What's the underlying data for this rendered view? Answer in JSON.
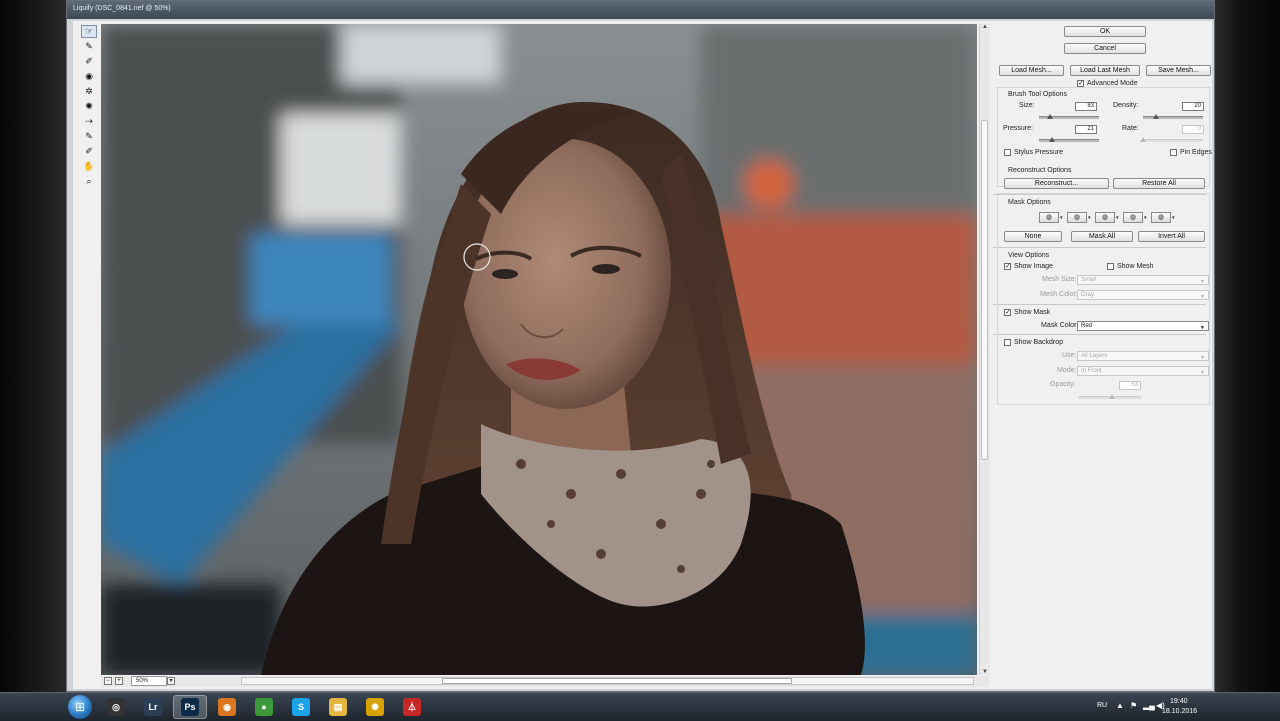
{
  "window": {
    "title": "Liquify (DSC_0841.nef @ 50%)"
  },
  "tools": [
    {
      "name": "forward-warp-tool-icon",
      "glyph": "☞"
    },
    {
      "name": "reconstruct-tool-icon",
      "glyph": "✎"
    },
    {
      "name": "smooth-tool-icon",
      "glyph": "✐"
    },
    {
      "name": "twirl-tool-icon",
      "glyph": "◉"
    },
    {
      "name": "pucker-tool-icon",
      "glyph": "✲"
    },
    {
      "name": "bloat-tool-icon",
      "glyph": "✺"
    },
    {
      "name": "push-left-tool-icon",
      "glyph": "⇢"
    },
    {
      "name": "freeze-mask-tool-icon",
      "glyph": "✎"
    },
    {
      "name": "thaw-mask-tool-icon",
      "glyph": "✐"
    },
    {
      "name": "hand-tool-icon",
      "glyph": "✋"
    },
    {
      "name": "zoom-tool-icon",
      "glyph": "⌕"
    }
  ],
  "status": {
    "zoom": "50%"
  },
  "panel": {
    "ok": "OK",
    "cancel": "Cancel",
    "load_mesh": "Load Mesh...",
    "load_last_mesh": "Load Last Mesh",
    "save_mesh": "Save Mesh...",
    "advanced_mode": "Advanced Mode",
    "brush_tool_options": "Brush Tool Options",
    "size_label": "Size:",
    "size_value": "83",
    "density_label": "Density:",
    "density_value": "20",
    "pressure_label": "Pressure:",
    "pressure_value": "21",
    "rate_label": "Rate:",
    "rate_value": "0",
    "stylus_pressure": "Stylus Pressure",
    "pin_edges": "Pin Edges",
    "reconstruct_options": "Reconstruct Options",
    "reconstruct": "Reconstruct...",
    "restore_all": "Restore All",
    "mask_options": "Mask Options",
    "none": "None",
    "mask_all": "Mask All",
    "invert_all": "Invert All",
    "view_options": "View Options",
    "show_image": "Show Image",
    "show_mesh": "Show Mesh",
    "mesh_size_label": "Mesh Size:",
    "mesh_size_value": "Small",
    "mesh_color_label": "Mesh Color:",
    "mesh_color_value": "Gray",
    "show_mask": "Show Mask",
    "mask_color_label": "Mask Color:",
    "mask_color_value": "Red",
    "show_backdrop": "Show Backdrop",
    "use_label": "Use:",
    "use_value": "All Layers",
    "mode_label": "Mode:",
    "mode_value": "In Front",
    "opacity_label": "Opacity:",
    "opacity_value": "53"
  },
  "taskbar": {
    "apps": [
      {
        "name": "obs-app-icon",
        "glyph": "◎",
        "color": "#333333"
      },
      {
        "name": "lightroom-app-icon",
        "glyph": "Lr",
        "color": "#2c3e57"
      },
      {
        "name": "photoshop-app-icon",
        "glyph": "Ps",
        "color": "#0b2a4a"
      },
      {
        "name": "eye-app-icon",
        "glyph": "◉",
        "color": "#d9761e"
      },
      {
        "name": "chrome-app-icon",
        "glyph": "●",
        "color": "#3c9a3c"
      },
      {
        "name": "skype-app-icon",
        "glyph": "S",
        "color": "#1aa3e8"
      },
      {
        "name": "file-explorer-app-icon",
        "glyph": "▤",
        "color": "#e3b640"
      },
      {
        "name": "lightbulb-app-icon",
        "glyph": "✺",
        "color": "#d8a200"
      },
      {
        "name": "pdf-app-icon",
        "glyph": "⏃",
        "color": "#c62828"
      }
    ],
    "language": "RU",
    "time": "19:40",
    "date": "18.10.2016"
  },
  "colors": {
    "mask_red": "#c8201c",
    "accent": "#3d7ec6"
  }
}
